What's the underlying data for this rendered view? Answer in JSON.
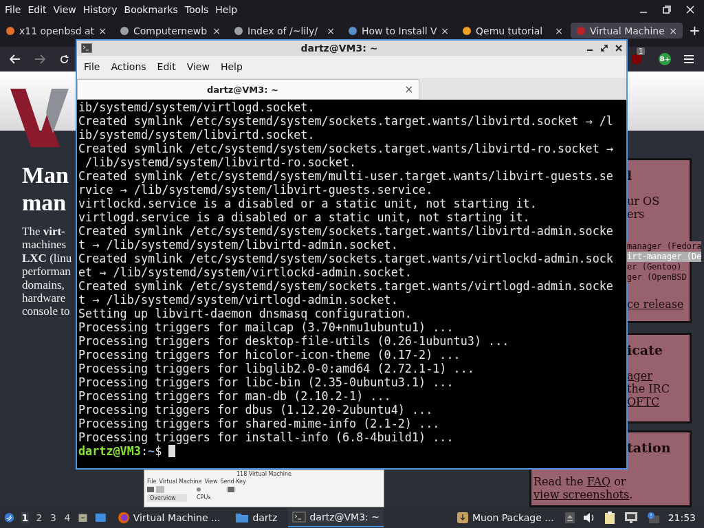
{
  "browser": {
    "menu": [
      "File",
      "Edit",
      "View",
      "History",
      "Bookmarks",
      "Tools",
      "Help"
    ],
    "tabs": [
      {
        "title": "x11 openbsd at",
        "selected": false
      },
      {
        "title": "Computernewb",
        "selected": false
      },
      {
        "title": "Index of /~lily/",
        "selected": false
      },
      {
        "title": "How to Install V",
        "selected": false
      },
      {
        "title": "Qemu tutorial",
        "selected": false
      },
      {
        "title": "Virtual Machine",
        "selected": true
      }
    ],
    "close_glyph": "×",
    "new_tab": "+",
    "badge": "1",
    "extension_label": "B+"
  },
  "page": {
    "heading_lines": [
      "Man",
      "man"
    ],
    "intro_lines": [
      "The **virt-**",
      "machines",
      "**LXC** (linu",
      "performan",
      "domains,",
      "hardware",
      "console to"
    ],
    "boxes": [
      {
        "heading": "l",
        "lines": [
          {
            "kind": "text",
            "text": "ur OS"
          },
          {
            "kind": "text",
            "text": "ers"
          },
          {
            "kind": "code",
            "text": "manager (Fedora"
          },
          {
            "kind": "highlight",
            "text": "irt-manager (De"
          },
          {
            "kind": "code",
            "text": "er (Gentoo)"
          },
          {
            "kind": "code",
            "text": "ger (OpenBSD"
          },
          {
            "kind": "link",
            "text": "ce release"
          }
        ]
      },
      {
        "heading": "icate",
        "lines": [
          {
            "kind": "link",
            "text": "ager"
          },
          {
            "kind": "text",
            "text": "the IRC"
          },
          {
            "kind": "link",
            "text": "OFTC"
          }
        ]
      },
      {
        "heading": "tation",
        "paragraph": [
          {
            "text": "Read the ",
            "link": false
          },
          {
            "text": "FAQ",
            "link": true
          },
          {
            "text": " or ",
            "link": false
          },
          {
            "text": "view ",
            "link": true
          },
          {
            "text": "screenshots",
            "link": true
          },
          {
            "text": ".",
            "link": false
          }
        ]
      }
    ]
  },
  "terminal": {
    "title": "dartz@VM3: ~",
    "menu": [
      "File",
      "Actions",
      "Edit",
      "View",
      "Help"
    ],
    "tab": "dartz@VM3: ~",
    "tab_close": "×",
    "lines": [
      "ib/systemd/system/virtlogd.socket.",
      "Created symlink /etc/systemd/system/sockets.target.wants/libvirtd.socket → /l",
      "ib/systemd/system/libvirtd.socket.",
      "Created symlink /etc/systemd/system/sockets.target.wants/libvirtd-ro.socket →",
      " /lib/systemd/system/libvirtd-ro.socket.",
      "Created symlink /etc/systemd/system/multi-user.target.wants/libvirt-guests.se",
      "rvice → /lib/systemd/system/libvirt-guests.service.",
      "virtlockd.service is a disabled or a static unit, not starting it.",
      "virtlogd.service is a disabled or a static unit, not starting it.",
      "Created symlink /etc/systemd/system/sockets.target.wants/libvirtd-admin.socke",
      "t → /lib/systemd/system/libvirtd-admin.socket.",
      "Created symlink /etc/systemd/system/sockets.target.wants/virtlockd-admin.sock",
      "et → /lib/systemd/system/virtlockd-admin.socket.",
      "Created symlink /etc/systemd/system/sockets.target.wants/virtlogd-admin.socke",
      "t → /lib/systemd/system/virtlogd-admin.socket.",
      "Setting up libvirt-daemon dnsmasq configuration.",
      "Processing triggers for mailcap (3.70+nmu1ubuntu1) ...",
      "Processing triggers for desktop-file-utils (0.26-1ubuntu3) ...",
      "Processing triggers for hicolor-icon-theme (0.17-2) ...",
      "Processing triggers for libglib2.0-0:amd64 (2.72.1-1) ...",
      "Processing triggers for libc-bin (2.35-0ubuntu3.1) ...",
      "Processing triggers for man-db (2.10.2-1) ...",
      "Processing triggers for dbus (1.12.20-2ubuntu4) ...",
      "Processing triggers for shared-mime-info (2.1-2) ...",
      "Processing triggers for install-info (6.8-4build1) ..."
    ],
    "prompt": {
      "user_host": "dartz@VM3",
      "colon": ":",
      "path": "~",
      "symbol": "$"
    }
  },
  "preview": {
    "title": "118 Virtual Machine",
    "menu": [
      "File",
      "Virtual Machine",
      "View",
      "Send Key"
    ],
    "sidebar_item": "Overview",
    "section": "CPUs"
  },
  "taskbar": {
    "workspaces": [
      {
        "label": "1",
        "selected": true
      },
      {
        "label": "2",
        "selected": false
      },
      {
        "label": "3",
        "selected": false
      },
      {
        "label": "4",
        "selected": false
      }
    ],
    "tasks": [
      {
        "kind": "browser",
        "label": "Virtual Machine ...",
        "selected": false
      },
      {
        "kind": "folder",
        "label": "dartz",
        "selected": false
      },
      {
        "kind": "terminal",
        "label": "dartz@VM3: ~",
        "selected": true
      },
      {
        "kind": "package",
        "label": "Muon Package ...",
        "selected": false
      }
    ],
    "clock": "21:53"
  }
}
